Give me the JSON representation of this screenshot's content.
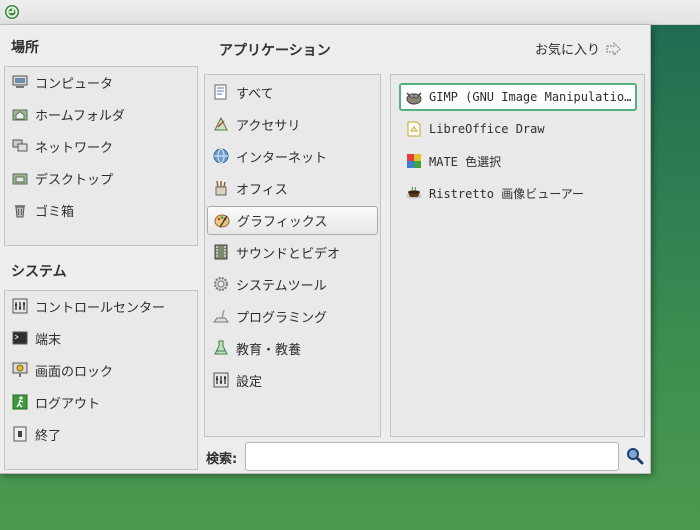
{
  "places": {
    "title": "場所",
    "items": [
      {
        "label": "コンピュータ",
        "icon": "computer-icon"
      },
      {
        "label": "ホームフォルダ",
        "icon": "home-folder-icon"
      },
      {
        "label": "ネットワーク",
        "icon": "network-icon"
      },
      {
        "label": "デスクトップ",
        "icon": "desktop-folder-icon"
      },
      {
        "label": "ゴミ箱",
        "icon": "trash-icon"
      }
    ]
  },
  "system": {
    "title": "システム",
    "items": [
      {
        "label": "コントロールセンター",
        "icon": "control-center-icon"
      },
      {
        "label": "端末",
        "icon": "terminal-icon"
      },
      {
        "label": "画面のロック",
        "icon": "lock-screen-icon"
      },
      {
        "label": "ログアウト",
        "icon": "logout-icon"
      },
      {
        "label": "終了",
        "icon": "shutdown-icon"
      }
    ]
  },
  "applications": {
    "title": "アプリケーション",
    "favorites_label": "お気に入り",
    "categories": [
      {
        "label": "すべて"
      },
      {
        "label": "アクセサリ"
      },
      {
        "label": "インターネット"
      },
      {
        "label": "オフィス"
      },
      {
        "label": "グラフィックス"
      },
      {
        "label": "サウンドとビデオ"
      },
      {
        "label": "システムツール"
      },
      {
        "label": "プログラミング"
      },
      {
        "label": "教育・教養"
      },
      {
        "label": "設定"
      }
    ],
    "selected_category": "グラフィックス",
    "apps": [
      {
        "label": "GIMP (GNU Image Manipulatio…",
        "icon": "gimp-icon"
      },
      {
        "label": "LibreOffice Draw",
        "icon": "libreoffice-draw-icon"
      },
      {
        "label": "MATE 色選択",
        "icon": "color-picker-icon"
      },
      {
        "label": "Ristretto 画像ビューアー",
        "icon": "image-viewer-icon"
      }
    ]
  },
  "search": {
    "label": "検索:",
    "value": ""
  },
  "colors": {
    "accent": "#52b17f",
    "panel": "#ededed"
  }
}
